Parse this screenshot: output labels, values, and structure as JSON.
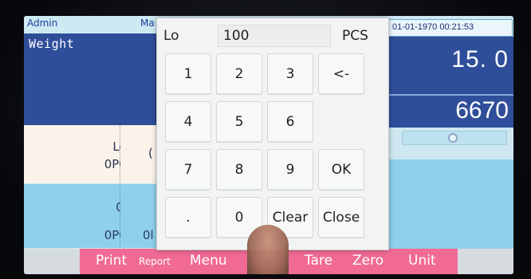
{
  "status": {
    "user": "Admin",
    "mode_fragment": "Ma",
    "datetime": "01-01-1970 00:21:53"
  },
  "weight_panel": {
    "label": "Weight"
  },
  "readouts": {
    "top_value": "15. 0",
    "bottom_value": "6670"
  },
  "left_cells": {
    "lo_name": "Lo",
    "lo_value": "0PCS",
    "lo_next_fragment": "(",
    "zero_name": "0",
    "zero_value": "0PCS",
    "zero_next_fragment": "0l"
  },
  "keypad": {
    "title": "Lo",
    "input_value": "100",
    "unit": "PCS",
    "keys": {
      "k1": "1",
      "k2": "2",
      "k3": "3",
      "back": "<-",
      "k4": "4",
      "k5": "5",
      "k6": "6",
      "k7": "7",
      "k8": "8",
      "k9": "9",
      "ok": "OK",
      "dot": ".",
      "k0": "0",
      "clear": "Clear",
      "close": "Close"
    }
  },
  "toolbar": {
    "print": "Print",
    "report": "Report",
    "menu": "Menu",
    "tare": "Tare",
    "zero": "Zero",
    "unit": "Unit"
  },
  "colors": {
    "panel_blue": "#2f4e9a",
    "light_blue": "#8fd0ec",
    "toolbar_pink": "#f06a93"
  }
}
